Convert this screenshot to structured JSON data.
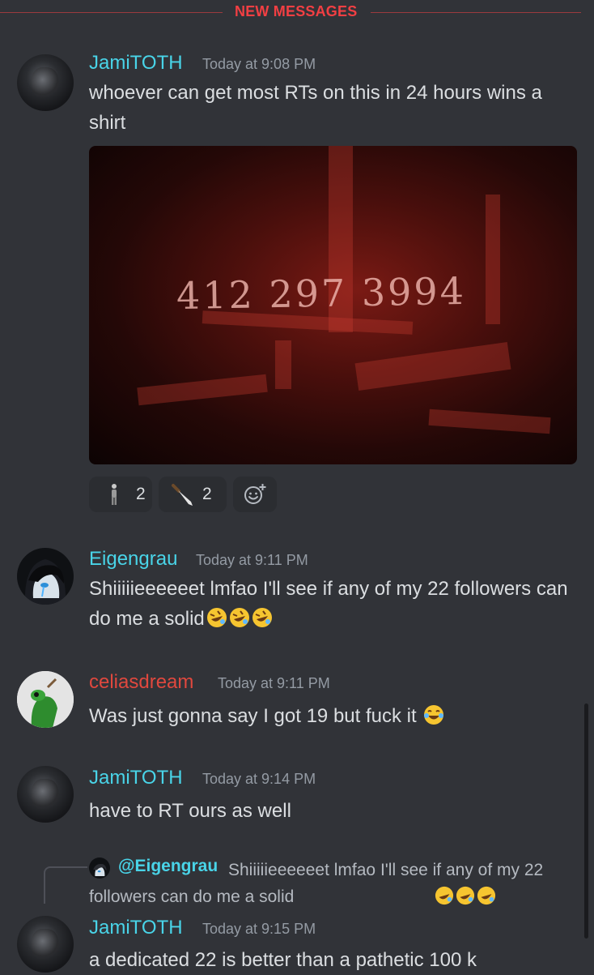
{
  "divider": {
    "label": "NEW MESSAGES"
  },
  "messages": [
    {
      "author": "JamiTOTH",
      "time": "Today at 9:08 PM",
      "text": "whoever can get most RTs on this in 24 hours wins a shirt"
    },
    {
      "author": "Eigengrau",
      "time": "Today at 9:11 PM",
      "text": "Shiiiiieeeeeet lmfao I'll see if any of my 22 followers can do me a solid"
    },
    {
      "author": "celiasdream",
      "time": "Today at 9:11 PM",
      "text": "Was just gonna say I got 19 but fuck it"
    },
    {
      "author": "JamiTOTH",
      "time": "Today at 9:14 PM",
      "text": "have to RT ours as well"
    },
    {
      "author": "JamiTOTH",
      "time": "Today at 9:15 PM",
      "text": "a dedicated 22 is better than a pathetic 100 k"
    }
  ],
  "attachment": {
    "handwritten_text": "412 297 3994"
  },
  "reactions": [
    {
      "emoji": "person-standing",
      "count": "2"
    },
    {
      "emoji": "knife",
      "count": "2"
    }
  ],
  "reply": {
    "mention": "@Eigengrau",
    "text": "Shiiiiieeeeeet lmfao I'll see if any of my 22 followers can do me a solid"
  },
  "colors": {
    "background": "#313338",
    "new_messages": "#f23f43",
    "teal_name": "#49d4e8",
    "red_name": "#e0483e"
  }
}
